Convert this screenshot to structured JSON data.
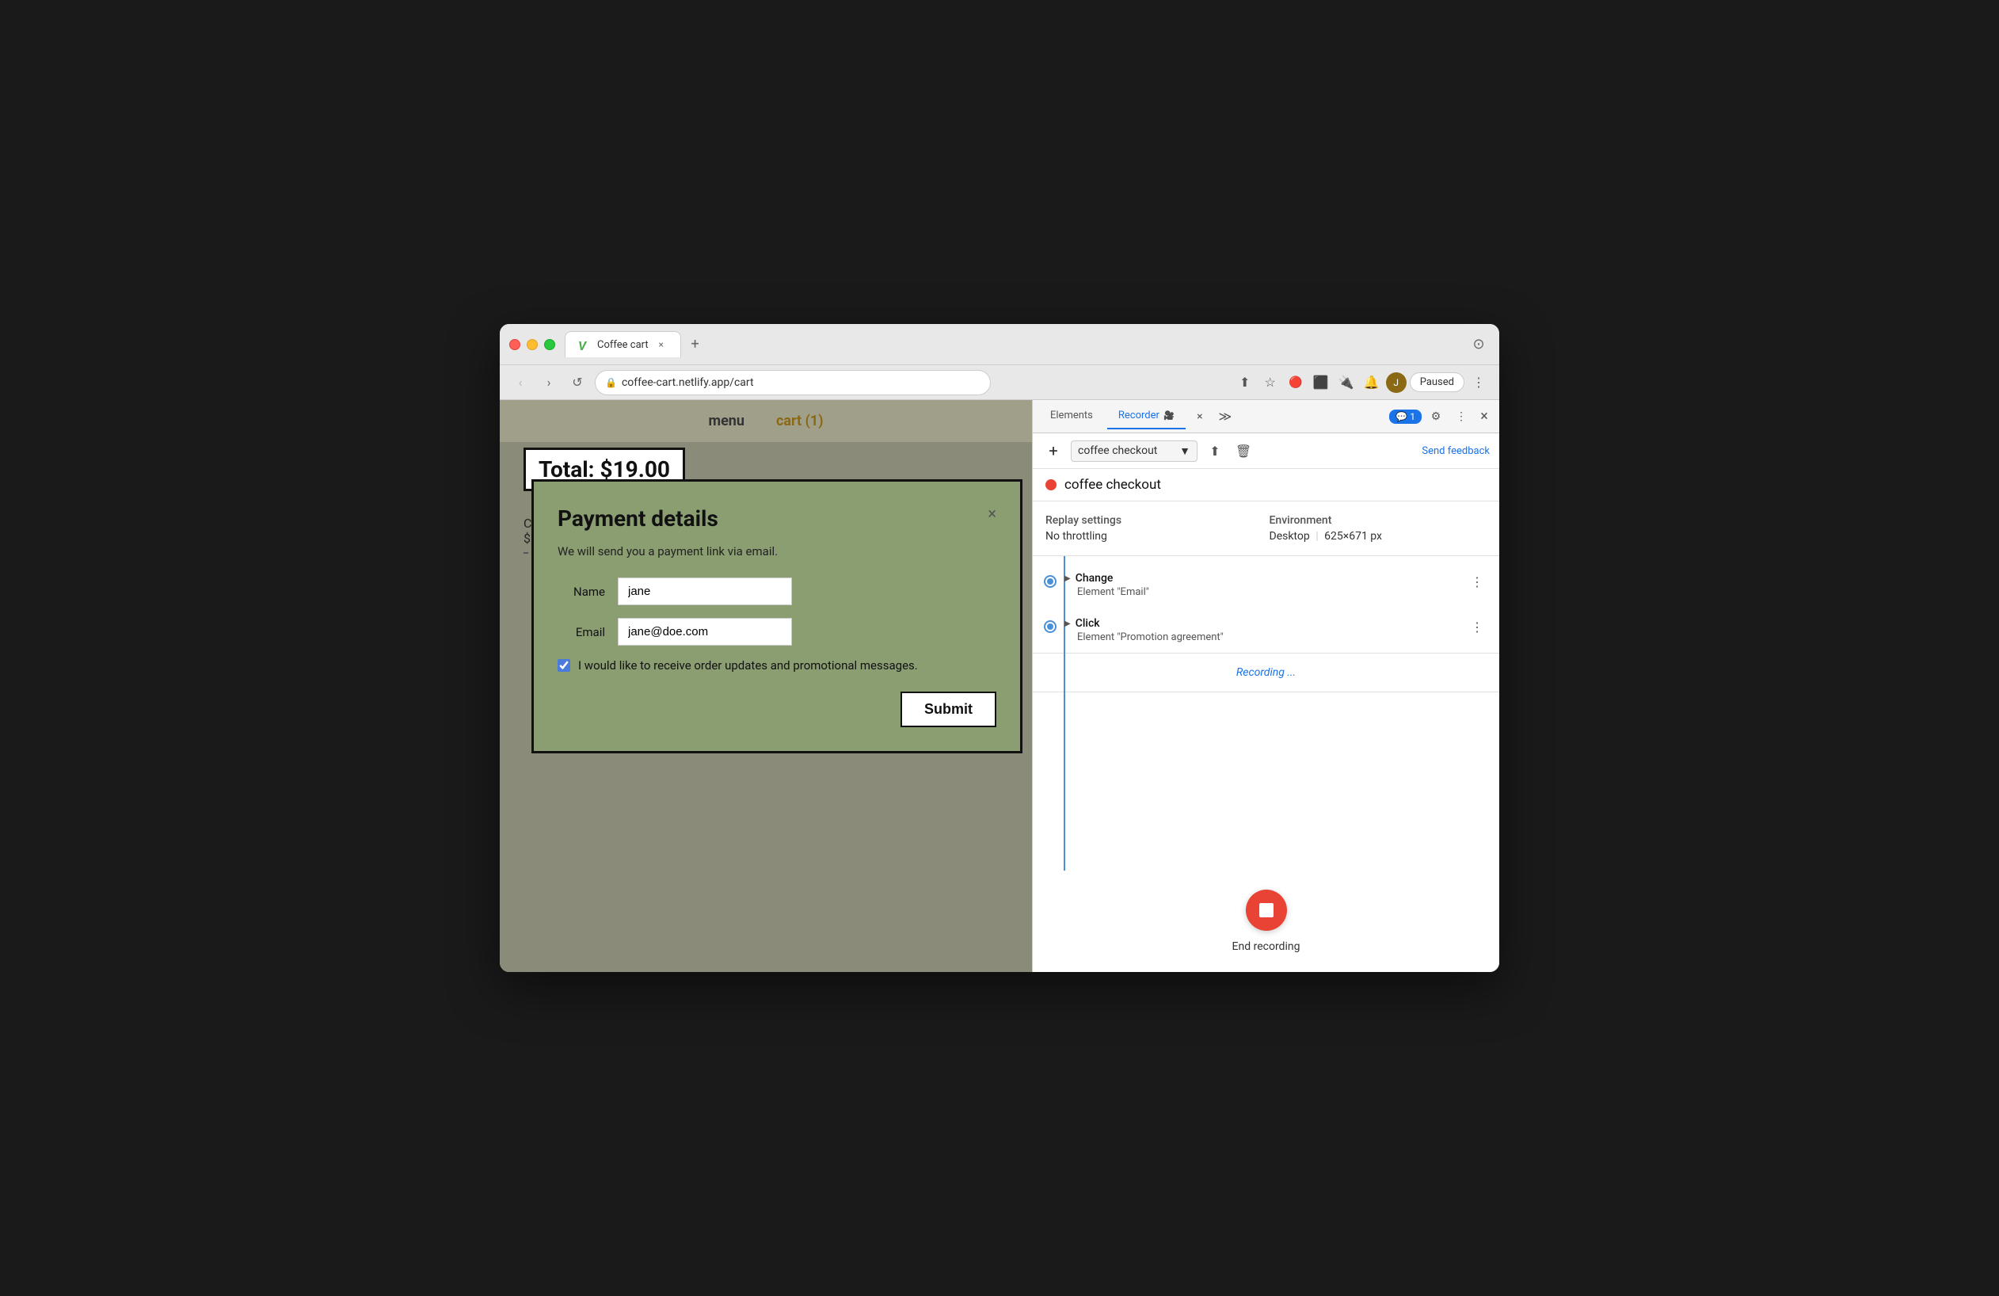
{
  "browser": {
    "traffic_lights": [
      "close",
      "minimize",
      "maximize"
    ],
    "tab": {
      "favicon": "▼",
      "title": "Coffee cart",
      "close_label": "×"
    },
    "new_tab_label": "+",
    "nav": {
      "back_label": "‹",
      "forward_label": "›",
      "reload_label": "↺"
    },
    "url": "coffee-cart.netlify.app/cart",
    "url_icon": "🔒",
    "browser_actions": [
      "⬆",
      "☆",
      "🔴",
      "⬛",
      "🔌",
      "🔔"
    ],
    "paused_label": "Paused",
    "more_label": "⋮"
  },
  "webpage": {
    "nav_items": [
      "menu",
      "cart (1)"
    ],
    "total_label": "Total: $19.00",
    "cart_item": "Ca...",
    "modal": {
      "title": "Payment details",
      "close_label": "×",
      "subtitle": "We will send you a payment link via email.",
      "name_label": "Name",
      "name_value": "jane",
      "email_label": "Email",
      "email_value": "jane@doe.com",
      "checkbox_label": "I would like to receive order updates and promotional messages.",
      "checkbox_checked": true,
      "submit_label": "Submit"
    }
  },
  "devtools": {
    "tabs": [
      {
        "label": "Elements",
        "active": false
      },
      {
        "label": "Recorder",
        "active": true
      }
    ],
    "recorder_icon": "🎥",
    "close_tab_label": "×",
    "more_tabs_label": "≫",
    "chat_badge": "💬 1",
    "settings_label": "⚙",
    "more_label": "⋮",
    "close_label": "×",
    "toolbar": {
      "add_label": "+",
      "recording_name": "coffee checkout",
      "dropdown_label": "▼",
      "export_label": "⬆",
      "delete_label": "🗑",
      "send_feedback_label": "Send feedback"
    },
    "recording_title": {
      "dot_color": "#e84335",
      "name": "coffee checkout"
    },
    "replay_settings": {
      "left_label": "Replay settings",
      "throttling_label": "No throttling",
      "right_label": "Environment",
      "env_label": "Desktop",
      "dimensions": "625×671 px"
    },
    "steps": [
      {
        "type": "Change",
        "element": "Element \"Email\"",
        "menu_label": "⋮"
      },
      {
        "type": "Click",
        "element": "Element \"Promotion agreement\"",
        "menu_label": "⋮"
      }
    ],
    "recording_status": "Recording ...",
    "end_recording": {
      "stop_label": "■",
      "label": "End recording"
    }
  }
}
